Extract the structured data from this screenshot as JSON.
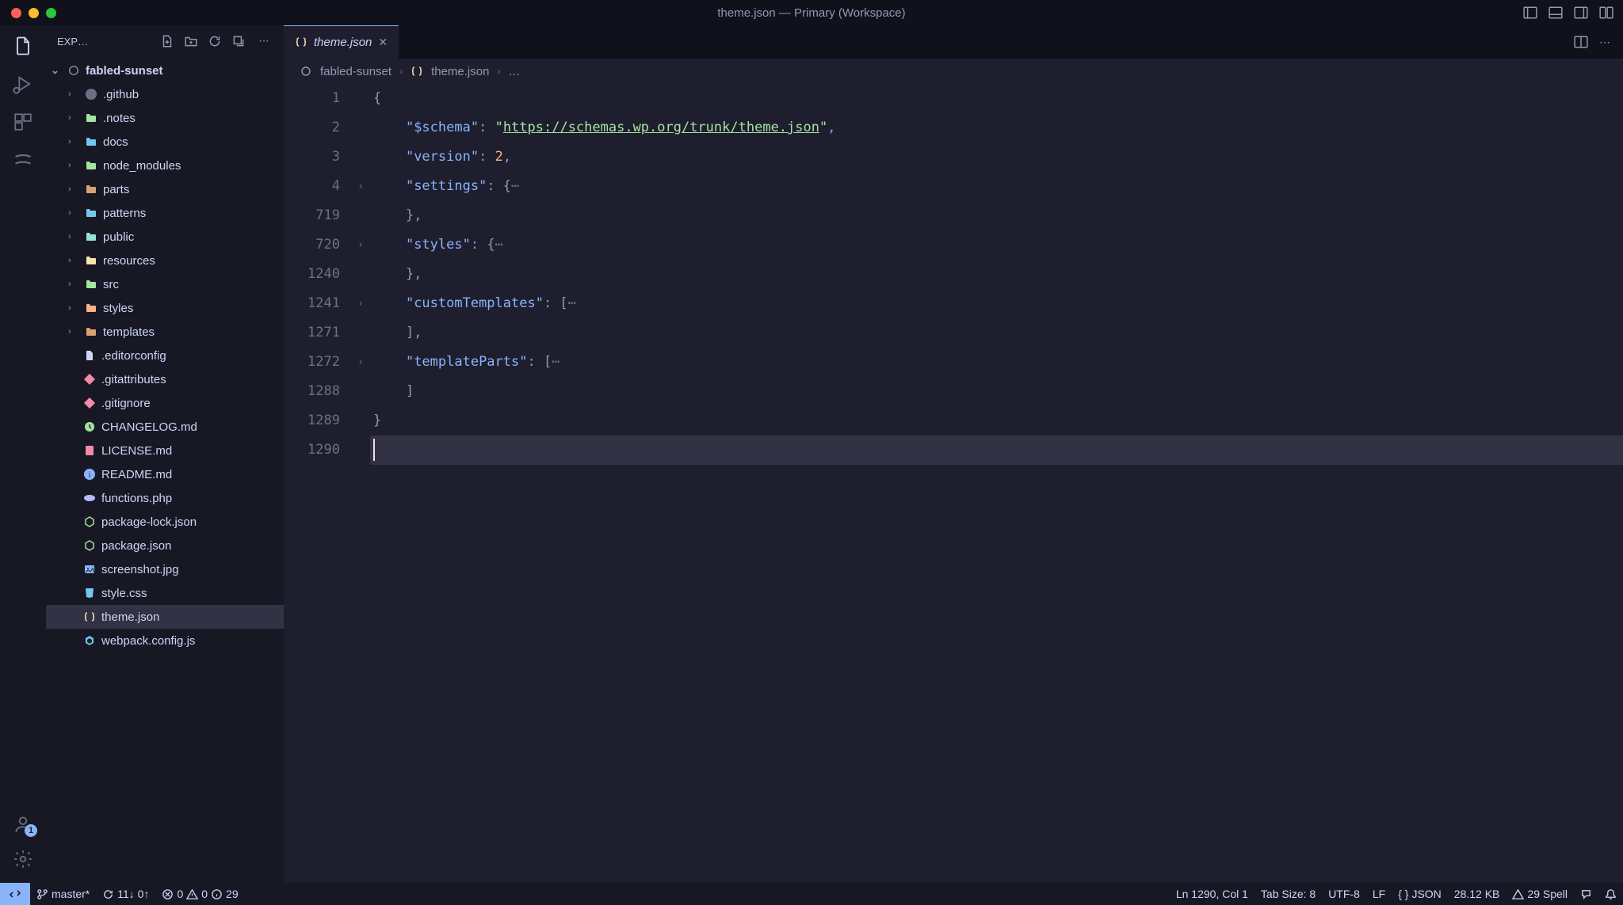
{
  "titlebar": {
    "title": "theme.json — Primary (Workspace)"
  },
  "sidebar": {
    "header_label": "EXP…",
    "root_name": "fabled-sunset",
    "folders": [
      {
        "name": ".github",
        "icon": "github"
      },
      {
        "name": ".notes",
        "icon": "folder-green"
      },
      {
        "name": "docs",
        "icon": "folder-blue"
      },
      {
        "name": "node_modules",
        "icon": "folder-green"
      },
      {
        "name": "parts",
        "icon": "folder-brown"
      },
      {
        "name": "patterns",
        "icon": "folder-blue"
      },
      {
        "name": "public",
        "icon": "folder-teal"
      },
      {
        "name": "resources",
        "icon": "folder-yellow"
      },
      {
        "name": "src",
        "icon": "folder-green"
      },
      {
        "name": "styles",
        "icon": "folder-orange"
      },
      {
        "name": "templates",
        "icon": "folder-brown"
      }
    ],
    "files": [
      {
        "name": ".editorconfig",
        "icon": "config"
      },
      {
        "name": ".gitattributes",
        "icon": "git"
      },
      {
        "name": ".gitignore",
        "icon": "git"
      },
      {
        "name": "CHANGELOG.md",
        "icon": "changelog"
      },
      {
        "name": "LICENSE.md",
        "icon": "license"
      },
      {
        "name": "README.md",
        "icon": "info"
      },
      {
        "name": "functions.php",
        "icon": "php"
      },
      {
        "name": "package-lock.json",
        "icon": "node"
      },
      {
        "name": "package.json",
        "icon": "node"
      },
      {
        "name": "screenshot.jpg",
        "icon": "image"
      },
      {
        "name": "style.css",
        "icon": "css"
      },
      {
        "name": "theme.json",
        "icon": "json",
        "selected": true
      },
      {
        "name": "webpack.config.js",
        "icon": "webpack"
      }
    ]
  },
  "tab": {
    "label": "theme.json"
  },
  "breadcrumb": {
    "repo": "fabled-sunset",
    "file": "theme.json",
    "more": "…"
  },
  "editor": {
    "lines": [
      {
        "num": "1",
        "fold": "",
        "html": "<span class='tok-brace'>{</span>"
      },
      {
        "num": "2",
        "fold": "",
        "html": "    <span class='tok-key'>\"$schema\"</span><span class='tok-punc'>: </span><span class='tok-str'>\"</span><span class='tok-url'>https://schemas.wp.org/trunk/theme.json</span><span class='tok-str'>\"</span><span class='tok-punc'>,</span>"
      },
      {
        "num": "3",
        "fold": "",
        "html": "    <span class='tok-key'>\"version\"</span><span class='tok-punc'>: </span><span class='tok-num'>2</span><span class='tok-punc'>,</span>"
      },
      {
        "num": "4",
        "fold": ">",
        "html": "    <span class='tok-key'>\"settings\"</span><span class='tok-punc'>: {</span><span class='tok-fold'>⋯</span>"
      },
      {
        "num": "719",
        "fold": "",
        "html": "    <span class='tok-punc'>},</span>"
      },
      {
        "num": "720",
        "fold": ">",
        "html": "    <span class='tok-key'>\"styles\"</span><span class='tok-punc'>: {</span><span class='tok-fold'>⋯</span>"
      },
      {
        "num": "1240",
        "fold": "",
        "html": "    <span class='tok-punc'>},</span>"
      },
      {
        "num": "1241",
        "fold": ">",
        "html": "    <span class='tok-key'>\"customTemplates\"</span><span class='tok-punc'>: [</span><span class='tok-fold'>⋯</span>"
      },
      {
        "num": "1271",
        "fold": "",
        "html": "    <span class='tok-punc'>],</span>"
      },
      {
        "num": "1272",
        "fold": ">",
        "html": "    <span class='tok-key'>\"templateParts\"</span><span class='tok-punc'>: [</span><span class='tok-fold'>⋯</span>"
      },
      {
        "num": "1288",
        "fold": "",
        "html": "    <span class='tok-punc'>]</span>"
      },
      {
        "num": "1289",
        "fold": "",
        "html": "<span class='tok-brace'>}</span>"
      },
      {
        "num": "1290",
        "fold": "",
        "html": "",
        "current": true
      }
    ]
  },
  "statusbar": {
    "branch": "master*",
    "sync": "11↓ 0↑",
    "errors": "0",
    "warnings": "0",
    "info": "29",
    "cursor": "Ln 1290, Col 1",
    "tabsize": "Tab Size: 8",
    "encoding": "UTF-8",
    "eol": "LF",
    "lang": "JSON",
    "filesize": "28.12 KB",
    "spell": "29 Spell"
  },
  "colors": {
    "folder_github": "#6c7086",
    "folder_green": "#a6e3a1",
    "folder_blue": "#74c7ec",
    "folder_brown": "#d8a373",
    "folder_teal": "#94e2d5",
    "folder_yellow": "#f9e2af",
    "folder_orange": "#fab387",
    "git": "#f38ba8",
    "node": "#a6e3a1",
    "php": "#b4befe",
    "css": "#74c7ec",
    "json": "#f9e2af",
    "image": "#89b4fa",
    "info": "#89b4fa",
    "license": "#f38ba8",
    "changelog": "#a6e3a1"
  }
}
